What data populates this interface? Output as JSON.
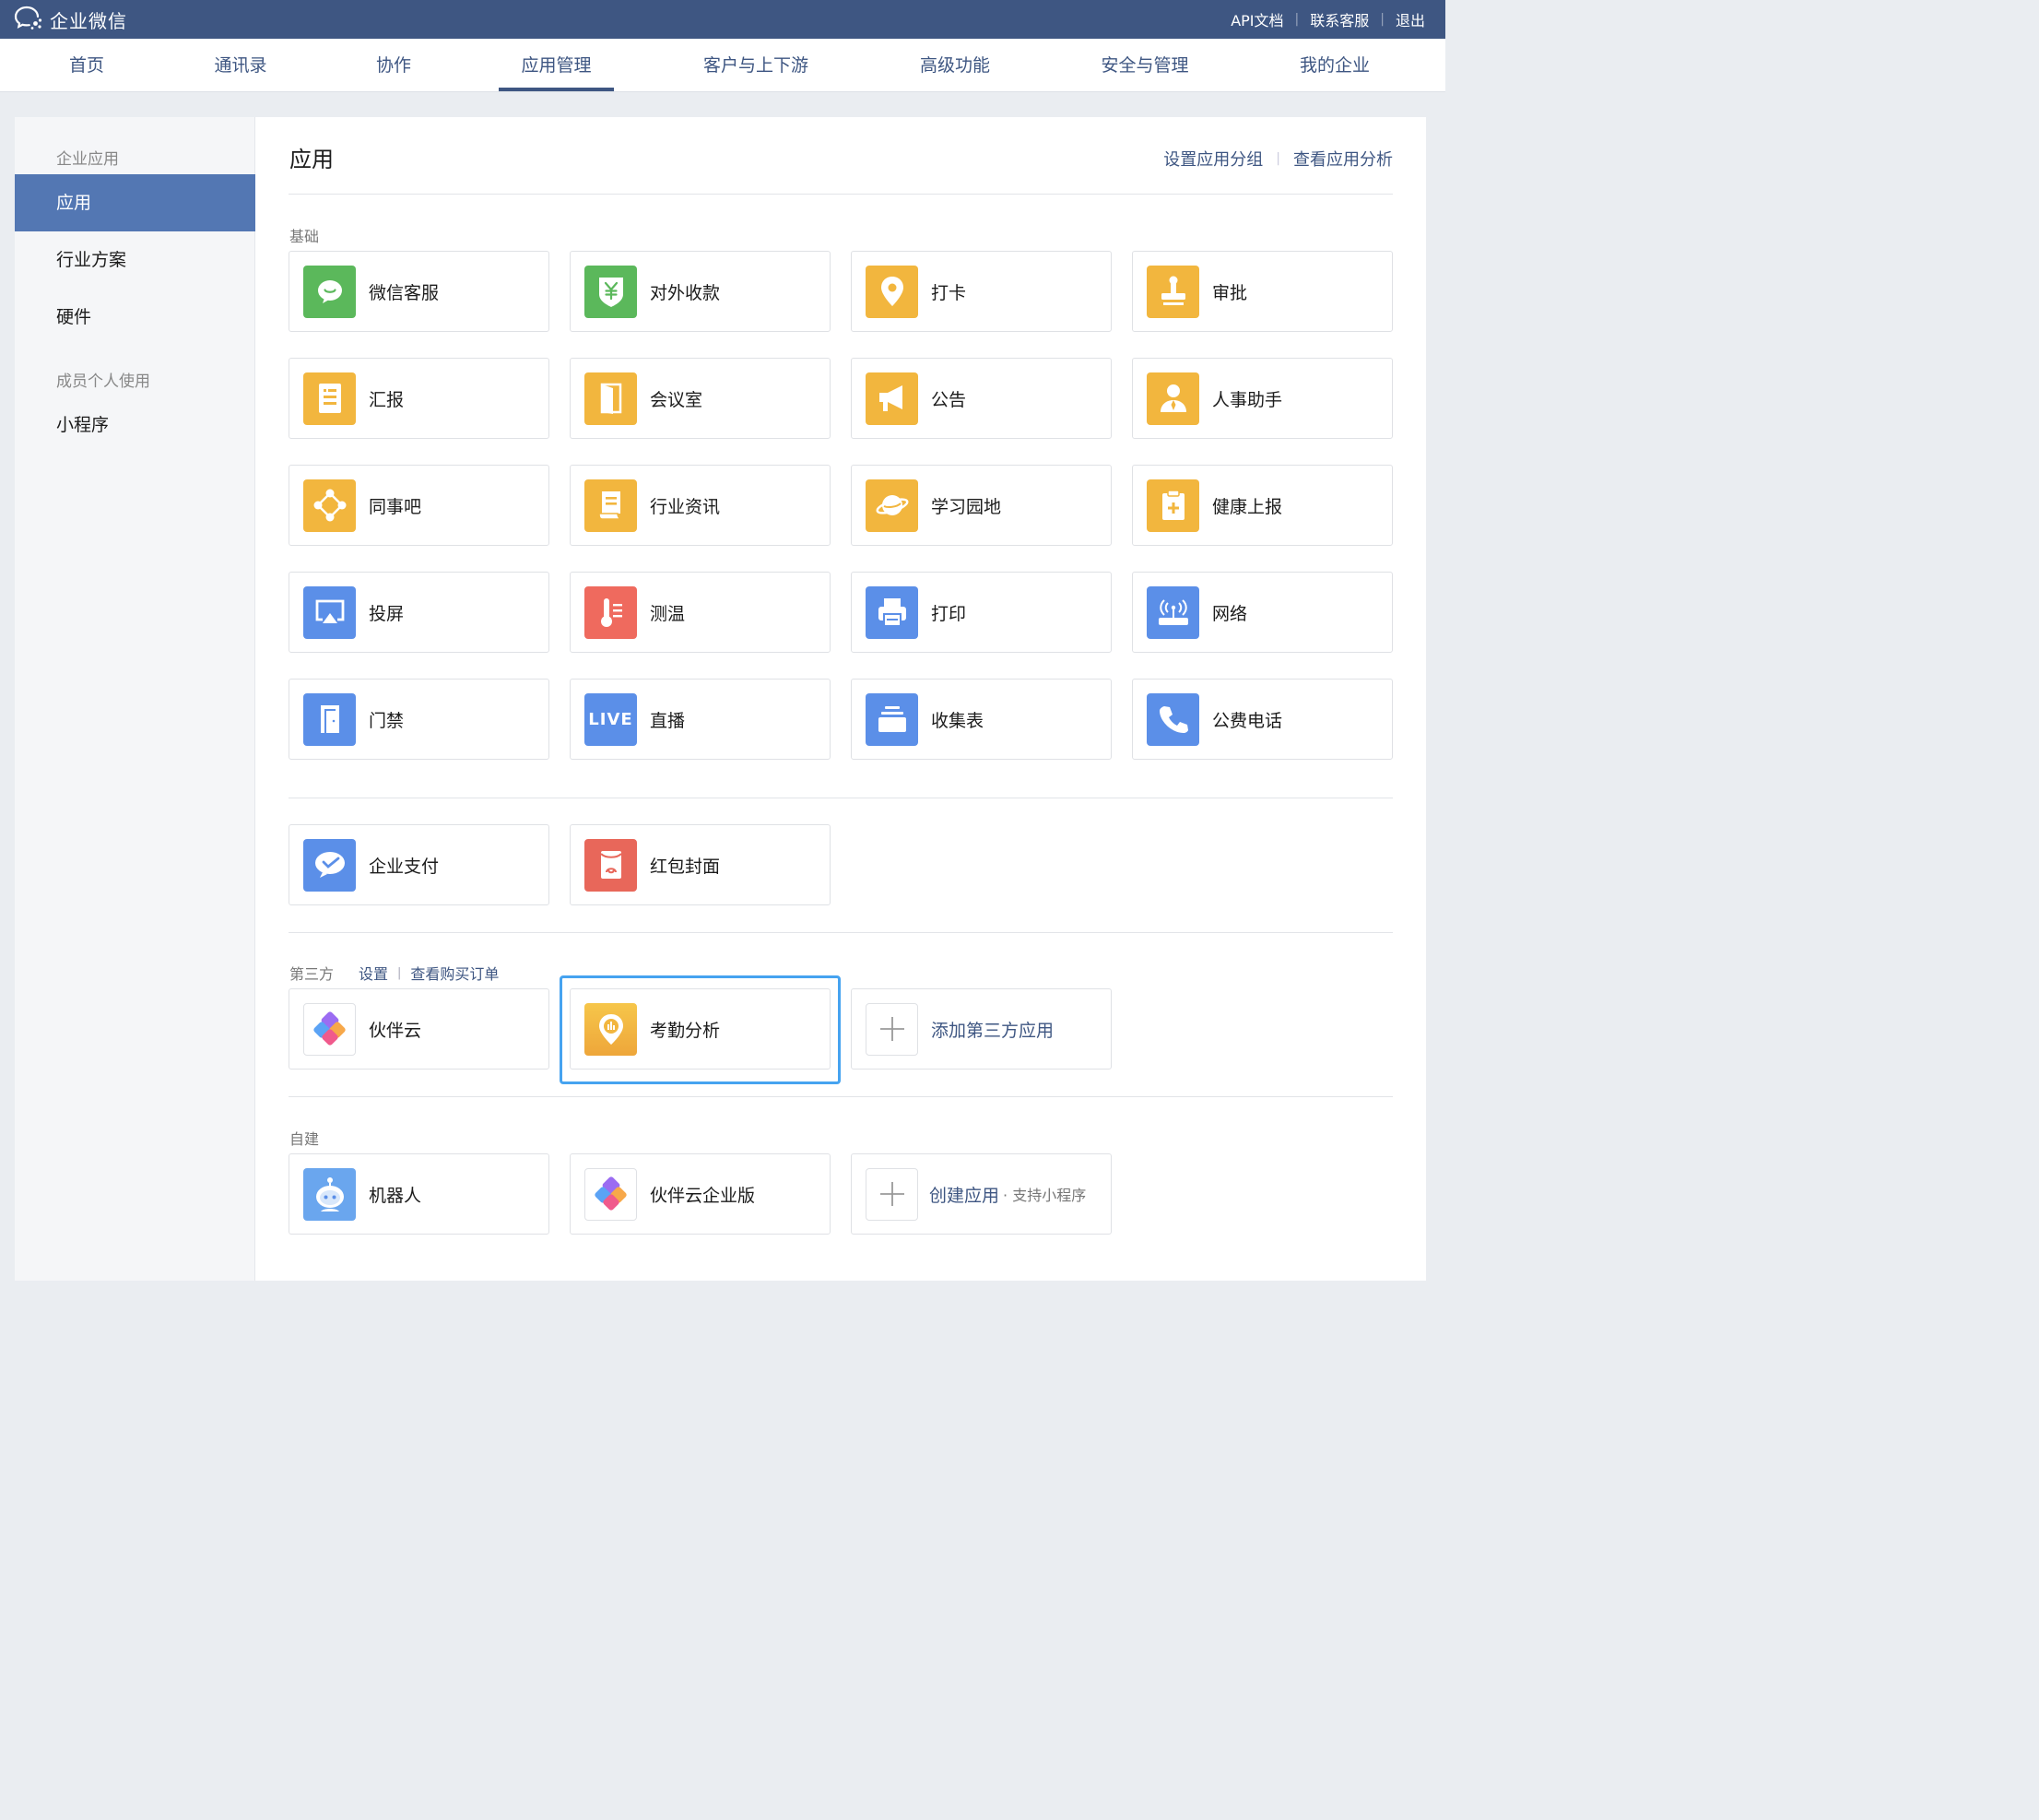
{
  "header": {
    "brand": "企业微信",
    "links": [
      "API文档",
      "联系客服",
      "退出"
    ]
  },
  "nav": {
    "tabs": [
      "首页",
      "通讯录",
      "协作",
      "应用管理",
      "客户与上下游",
      "高级功能",
      "安全与管理",
      "我的企业"
    ],
    "active": "应用管理"
  },
  "sidebar": {
    "group1": "企业应用",
    "items1": [
      "应用",
      "行业方案",
      "硬件"
    ],
    "active": "应用",
    "group2": "成员个人使用",
    "items2": [
      "小程序"
    ]
  },
  "main": {
    "title": "应用",
    "links": [
      "设置应用分组",
      "查看应用分析"
    ],
    "sections": {
      "basic": {
        "label": "基础",
        "apps": [
          {
            "name": "微信客服",
            "icon": "wechat-service-icon",
            "color": "#5bb85b"
          },
          {
            "name": "对外收款",
            "icon": "yuan-shield-icon",
            "color": "#5bb85b"
          },
          {
            "name": "打卡",
            "icon": "location-pin-icon",
            "color": "#f2b63e"
          },
          {
            "name": "审批",
            "icon": "stamp-icon",
            "color": "#f2b63e"
          },
          {
            "name": "汇报",
            "icon": "report-doc-icon",
            "color": "#f2b63e"
          },
          {
            "name": "会议室",
            "icon": "door-open-icon",
            "color": "#f2b63e"
          },
          {
            "name": "公告",
            "icon": "megaphone-icon",
            "color": "#f2b63e"
          },
          {
            "name": "人事助手",
            "icon": "person-tie-icon",
            "color": "#f2b63e"
          },
          {
            "name": "同事吧",
            "icon": "network-nodes-icon",
            "color": "#f2b63e"
          },
          {
            "name": "行业资讯",
            "icon": "scroll-doc-icon",
            "color": "#f2b63e"
          },
          {
            "name": "学习园地",
            "icon": "planet-icon",
            "color": "#f2b63e"
          },
          {
            "name": "健康上报",
            "icon": "health-clipboard-icon",
            "color": "#f2b63e"
          },
          {
            "name": "投屏",
            "icon": "screen-cast-icon",
            "color": "#5b8fe8"
          },
          {
            "name": "测温",
            "icon": "thermometer-icon",
            "color": "#ef6a5e"
          },
          {
            "name": "打印",
            "icon": "printer-icon",
            "color": "#5b8fe8"
          },
          {
            "name": "网络",
            "icon": "router-icon",
            "color": "#5b8fe8"
          },
          {
            "name": "门禁",
            "icon": "door-icon",
            "color": "#5b8fe8"
          },
          {
            "name": "直播",
            "icon": "live-icon",
            "icon_text": "LIVE",
            "color": "#5b8fe8"
          },
          {
            "name": "收集表",
            "icon": "collect-form-icon",
            "color": "#5b8fe8"
          },
          {
            "name": "公费电话",
            "icon": "phone-icon",
            "color": "#5b8fe8"
          }
        ]
      },
      "extra": {
        "apps": [
          {
            "name": "企业支付",
            "icon": "wechat-pay-icon",
            "color": "#5b8fe8"
          },
          {
            "name": "红包封面",
            "icon": "red-envelope-icon",
            "color": "#e8675a"
          }
        ]
      },
      "third": {
        "label": "第三方",
        "links": [
          "设置",
          "查看购买订单"
        ],
        "apps": [
          {
            "name": "伙伴云",
            "icon": "huoban-cloud-icon"
          },
          {
            "name": "考勤分析",
            "icon": "attendance-analysis-icon",
            "color": "#f2b63e"
          }
        ],
        "add_label": "添加第三方应用"
      },
      "custom": {
        "label": "自建",
        "apps": [
          {
            "name": "机器人",
            "icon": "robot-icon",
            "color": "#6aa6ee"
          },
          {
            "name": "伙伴云企业版",
            "icon": "huoban-cloud-enterprise-icon"
          }
        ],
        "create_label": "创建应用",
        "create_sub": "· 支持小程序"
      }
    }
  }
}
